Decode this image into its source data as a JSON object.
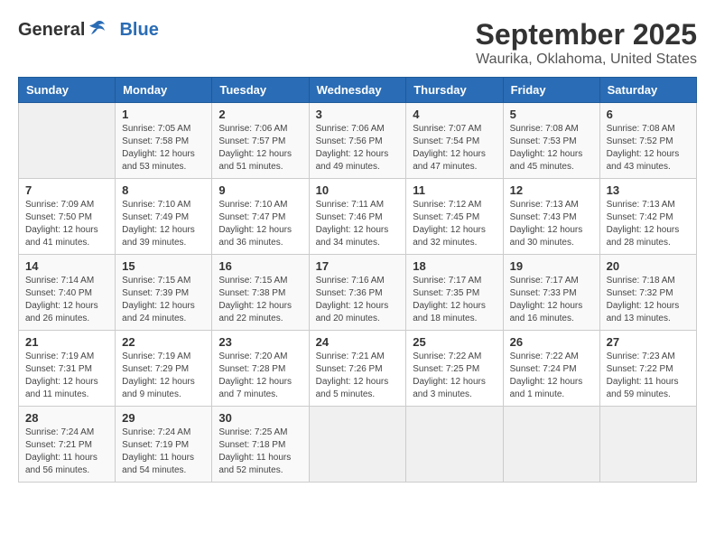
{
  "logo": {
    "general": "General",
    "blue": "Blue"
  },
  "title": "September 2025",
  "location": "Waurika, Oklahoma, United States",
  "days_of_week": [
    "Sunday",
    "Monday",
    "Tuesday",
    "Wednesday",
    "Thursday",
    "Friday",
    "Saturday"
  ],
  "weeks": [
    [
      {
        "day": "",
        "content": ""
      },
      {
        "day": "1",
        "content": "Sunrise: 7:05 AM\nSunset: 7:58 PM\nDaylight: 12 hours and 53 minutes."
      },
      {
        "day": "2",
        "content": "Sunrise: 7:06 AM\nSunset: 7:57 PM\nDaylight: 12 hours and 51 minutes."
      },
      {
        "day": "3",
        "content": "Sunrise: 7:06 AM\nSunset: 7:56 PM\nDaylight: 12 hours and 49 minutes."
      },
      {
        "day": "4",
        "content": "Sunrise: 7:07 AM\nSunset: 7:54 PM\nDaylight: 12 hours and 47 minutes."
      },
      {
        "day": "5",
        "content": "Sunrise: 7:08 AM\nSunset: 7:53 PM\nDaylight: 12 hours and 45 minutes."
      },
      {
        "day": "6",
        "content": "Sunrise: 7:08 AM\nSunset: 7:52 PM\nDaylight: 12 hours and 43 minutes."
      }
    ],
    [
      {
        "day": "7",
        "content": "Sunrise: 7:09 AM\nSunset: 7:50 PM\nDaylight: 12 hours and 41 minutes."
      },
      {
        "day": "8",
        "content": "Sunrise: 7:10 AM\nSunset: 7:49 PM\nDaylight: 12 hours and 39 minutes."
      },
      {
        "day": "9",
        "content": "Sunrise: 7:10 AM\nSunset: 7:47 PM\nDaylight: 12 hours and 36 minutes."
      },
      {
        "day": "10",
        "content": "Sunrise: 7:11 AM\nSunset: 7:46 PM\nDaylight: 12 hours and 34 minutes."
      },
      {
        "day": "11",
        "content": "Sunrise: 7:12 AM\nSunset: 7:45 PM\nDaylight: 12 hours and 32 minutes."
      },
      {
        "day": "12",
        "content": "Sunrise: 7:13 AM\nSunset: 7:43 PM\nDaylight: 12 hours and 30 minutes."
      },
      {
        "day": "13",
        "content": "Sunrise: 7:13 AM\nSunset: 7:42 PM\nDaylight: 12 hours and 28 minutes."
      }
    ],
    [
      {
        "day": "14",
        "content": "Sunrise: 7:14 AM\nSunset: 7:40 PM\nDaylight: 12 hours and 26 minutes."
      },
      {
        "day": "15",
        "content": "Sunrise: 7:15 AM\nSunset: 7:39 PM\nDaylight: 12 hours and 24 minutes."
      },
      {
        "day": "16",
        "content": "Sunrise: 7:15 AM\nSunset: 7:38 PM\nDaylight: 12 hours and 22 minutes."
      },
      {
        "day": "17",
        "content": "Sunrise: 7:16 AM\nSunset: 7:36 PM\nDaylight: 12 hours and 20 minutes."
      },
      {
        "day": "18",
        "content": "Sunrise: 7:17 AM\nSunset: 7:35 PM\nDaylight: 12 hours and 18 minutes."
      },
      {
        "day": "19",
        "content": "Sunrise: 7:17 AM\nSunset: 7:33 PM\nDaylight: 12 hours and 16 minutes."
      },
      {
        "day": "20",
        "content": "Sunrise: 7:18 AM\nSunset: 7:32 PM\nDaylight: 12 hours and 13 minutes."
      }
    ],
    [
      {
        "day": "21",
        "content": "Sunrise: 7:19 AM\nSunset: 7:31 PM\nDaylight: 12 hours and 11 minutes."
      },
      {
        "day": "22",
        "content": "Sunrise: 7:19 AM\nSunset: 7:29 PM\nDaylight: 12 hours and 9 minutes."
      },
      {
        "day": "23",
        "content": "Sunrise: 7:20 AM\nSunset: 7:28 PM\nDaylight: 12 hours and 7 minutes."
      },
      {
        "day": "24",
        "content": "Sunrise: 7:21 AM\nSunset: 7:26 PM\nDaylight: 12 hours and 5 minutes."
      },
      {
        "day": "25",
        "content": "Sunrise: 7:22 AM\nSunset: 7:25 PM\nDaylight: 12 hours and 3 minutes."
      },
      {
        "day": "26",
        "content": "Sunrise: 7:22 AM\nSunset: 7:24 PM\nDaylight: 12 hours and 1 minute."
      },
      {
        "day": "27",
        "content": "Sunrise: 7:23 AM\nSunset: 7:22 PM\nDaylight: 11 hours and 59 minutes."
      }
    ],
    [
      {
        "day": "28",
        "content": "Sunrise: 7:24 AM\nSunset: 7:21 PM\nDaylight: 11 hours and 56 minutes."
      },
      {
        "day": "29",
        "content": "Sunrise: 7:24 AM\nSunset: 7:19 PM\nDaylight: 11 hours and 54 minutes."
      },
      {
        "day": "30",
        "content": "Sunrise: 7:25 AM\nSunset: 7:18 PM\nDaylight: 11 hours and 52 minutes."
      },
      {
        "day": "",
        "content": ""
      },
      {
        "day": "",
        "content": ""
      },
      {
        "day": "",
        "content": ""
      },
      {
        "day": "",
        "content": ""
      }
    ]
  ]
}
